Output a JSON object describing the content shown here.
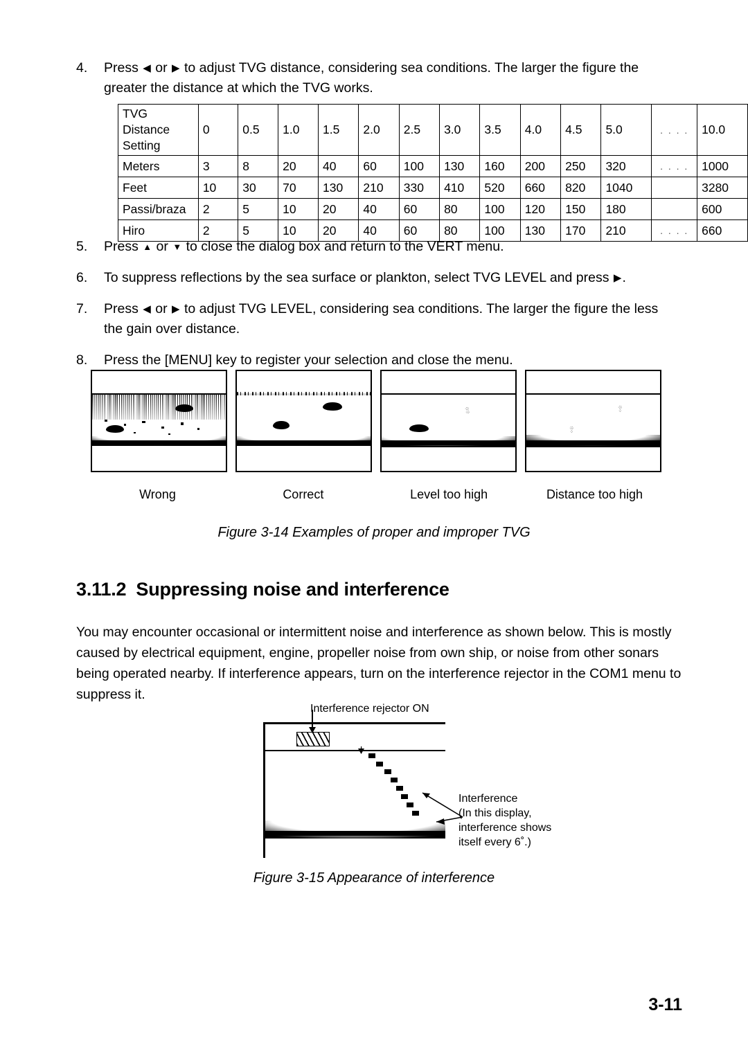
{
  "steps_top": [
    {
      "num": "4.",
      "parts": [
        {
          "t": "text",
          "v": "Press "
        },
        {
          "t": "icon",
          "v": "◀",
          "name": "left-arrow-icon"
        },
        {
          "t": "text",
          "v": " or "
        },
        {
          "t": "icon",
          "v": "▶",
          "name": "right-arrow-icon"
        },
        {
          "t": "text",
          "v": " to adjust TVG distance, considering sea conditions. The larger the figure the greater the distance at which the TVG works."
        }
      ],
      "plain": "Press ◀ or ▶ to adjust TVG distance, considering sea conditions. The larger the figure the greater the distance at which the TVG works."
    }
  ],
  "steps_bottom": [
    {
      "num": "5.",
      "plain": "Press ▲ or ▼ to close the dialog box and return to the VERT menu.",
      "pre": "Press ",
      "icon1": "▲",
      "mid": " or ",
      "icon2": "▼",
      "post": " to close the dialog box and return to the VERT menu."
    },
    {
      "num": "6.",
      "plain": "To suppress reflections by the sea surface or plankton, select TVG LEVEL and press ▶.",
      "pre": "To suppress reflections by the sea surface or plankton, select TVG LEVEL and press ",
      "icon1": "▶",
      "mid": "",
      "icon2": "",
      "post": "."
    },
    {
      "num": "7.",
      "plain": "Press ◀ or ▶ to adjust TVG LEVEL, considering sea conditions. The larger the figure the less the gain over distance.",
      "pre": "Press ",
      "icon1": "◀",
      "mid": " or ",
      "icon2": "▶",
      "post": " to adjust TVG LEVEL, considering sea conditions. The larger the figure the less the gain over distance."
    },
    {
      "num": "8.",
      "plain": "Press the [MENU] key to register your selection and close the menu.",
      "pre": "Press the [MENU] key to register your selection and close the menu.",
      "icon1": "",
      "mid": "",
      "icon2": "",
      "post": ""
    }
  ],
  "tvg_table": {
    "rows": [
      {
        "label": "TVG Distance Setting",
        "label_lines": [
          "TVG",
          "Distance",
          "Setting"
        ],
        "values": [
          "0",
          "0.5",
          "1.0",
          "1.5",
          "2.0",
          "2.5",
          "3.0",
          "3.5",
          "4.0",
          "4.5",
          "5.0",
          ". . . .",
          "10.0"
        ]
      },
      {
        "label": "Meters",
        "values": [
          "3",
          "8",
          "20",
          "40",
          "60",
          "100",
          "130",
          "160",
          "200",
          "250",
          "320",
          ". . . .",
          "1000"
        ]
      },
      {
        "label": "Feet",
        "values": [
          "10",
          "30",
          "70",
          "130",
          "210",
          "330",
          "410",
          "520",
          "660",
          "820",
          "1040",
          "",
          "3280"
        ]
      },
      {
        "label": "Passi/braza",
        "values": [
          "2",
          "5",
          "10",
          "20",
          "40",
          "60",
          "80",
          "100",
          "120",
          "150",
          "180",
          "",
          "600"
        ]
      },
      {
        "label": "Hiro",
        "values": [
          "2",
          "5",
          "10",
          "20",
          "40",
          "60",
          "80",
          "100",
          "130",
          "170",
          "210",
          ". . . .",
          "660"
        ]
      }
    ]
  },
  "panel_captions": [
    "Wrong",
    "Correct",
    "Level too high",
    "Distance too high"
  ],
  "figure_3_14_caption": "Figure 3-14 Examples of proper and improper TVG",
  "section": {
    "number": "3.11.2",
    "title": "Suppressing noise and interference"
  },
  "body_paragraph": "You may encounter occasional or intermittent noise and interference as shown below. This is mostly caused by electrical equipment, engine, propeller noise from own ship, or noise from other sonars being operated nearby. If interference appears, turn on the interference rejector in the COM1 menu to suppress it.",
  "interference_figure": {
    "title": "Interference rejector ON",
    "annotation_lines": [
      "Interference",
      "(In this display,",
      "interference shows",
      "itself every 6˚.)"
    ],
    "annotation_line_1": "Interference",
    "annotation_line_2": "(In this display,",
    "annotation_line_3": "interference shows",
    "annotation_line_4": "itself every 6˚.)"
  },
  "figure_3_15_caption": "Figure 3-15 Appearance of interference",
  "page_number": "3-11"
}
